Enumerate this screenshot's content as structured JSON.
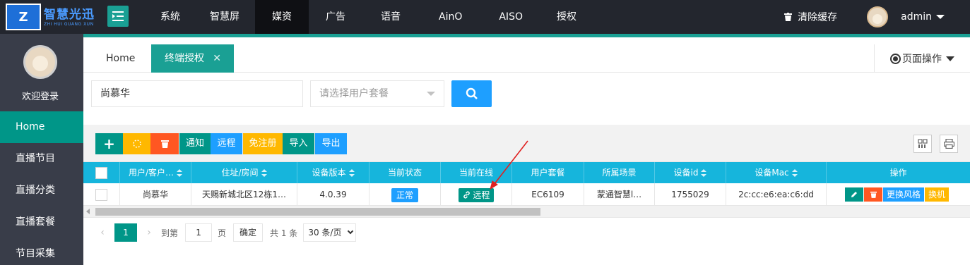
{
  "brand": {
    "name": "智慧光迅",
    "subtitle": "ZHI HUI GUANG XUN",
    "mark": "Z"
  },
  "topnav": [
    {
      "label": "系统"
    },
    {
      "label": "智慧屏"
    },
    {
      "label": "媒资",
      "active": true
    },
    {
      "label": "广告"
    },
    {
      "label": "语音"
    },
    {
      "label": "AinO"
    },
    {
      "label": "AISO"
    },
    {
      "label": "授权"
    }
  ],
  "header": {
    "clear_cache": "清除缓存",
    "username": "admin"
  },
  "sidebar": {
    "welcome": "欢迎登录",
    "items": [
      {
        "label": "Home",
        "active": true
      },
      {
        "label": "直播节目"
      },
      {
        "label": "直播分类"
      },
      {
        "label": "直播套餐"
      },
      {
        "label": "节目采集"
      }
    ]
  },
  "tabs": {
    "home": "Home",
    "active": "终端授权",
    "close": "✕",
    "page_ops": "页面操作"
  },
  "search": {
    "name_value": "尚慕华",
    "plan_placeholder": "请选择用户套餐"
  },
  "toolbar": {
    "add": "+",
    "notify": "通知",
    "remote": "远程",
    "free_register": "免注册",
    "import": "导入",
    "export": "导出"
  },
  "table": {
    "columns": [
      "用户/客户…",
      "住址/房间",
      "设备版本",
      "当前状态",
      "当前在线",
      "用户套餐",
      "所属场景",
      "设备id",
      "设备Mac",
      "操作"
    ],
    "rows": [
      {
        "user": "尚慕华",
        "address": "天赐新城北区12栋1…",
        "version": "4.0.39",
        "status": "正常",
        "online": "远程",
        "plan": "EC6109",
        "scene": "蒙通智慧l…",
        "device_id": "1755029",
        "mac": "2c:cc:e6:ea:c6:dd",
        "ops": {
          "style": "更换风格",
          "swap": "换机"
        }
      }
    ]
  },
  "pager": {
    "current": "1",
    "goto_prefix": "到第",
    "goto_value": "1",
    "goto_suffix": "页",
    "confirm": "确定",
    "total": "共 1 条",
    "page_size": "30 条/页"
  },
  "colors": {
    "accent": "#009688",
    "blue": "#1e9fff",
    "header": "#16b5dc",
    "orange": "#ff5722",
    "yellow": "#ffb800",
    "arrow": "#e02020"
  }
}
